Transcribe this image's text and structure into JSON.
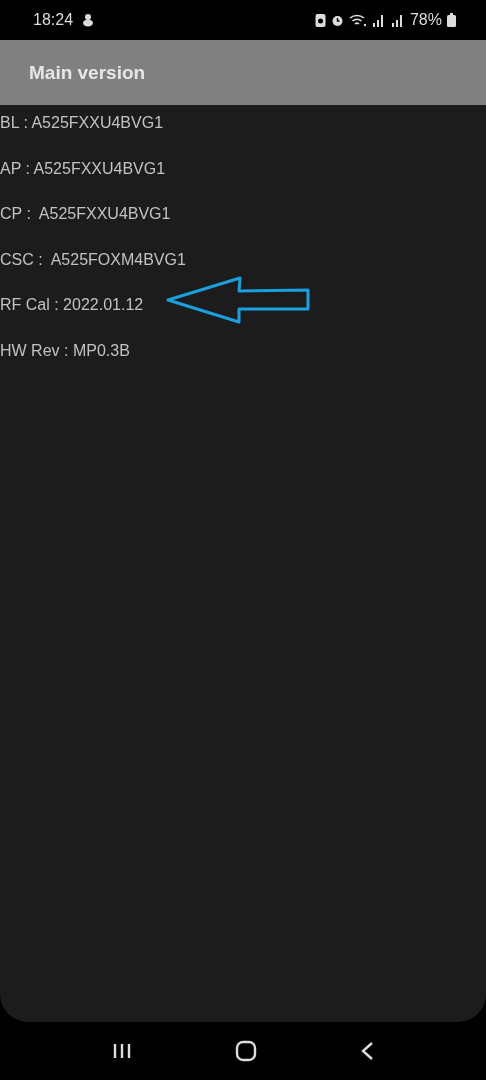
{
  "status_bar": {
    "time": "18:24",
    "battery": "78%"
  },
  "app_bar": {
    "title": "Main version"
  },
  "lines": [
    "BL : A525FXXU4BVG1",
    "AP : A525FXXU4BVG1",
    "CP :  A525FXXU4BVG1",
    "CSC :  A525FOXM4BVG1",
    "RF Cal : 2022.01.12",
    "HW Rev : MP0.3B"
  ]
}
